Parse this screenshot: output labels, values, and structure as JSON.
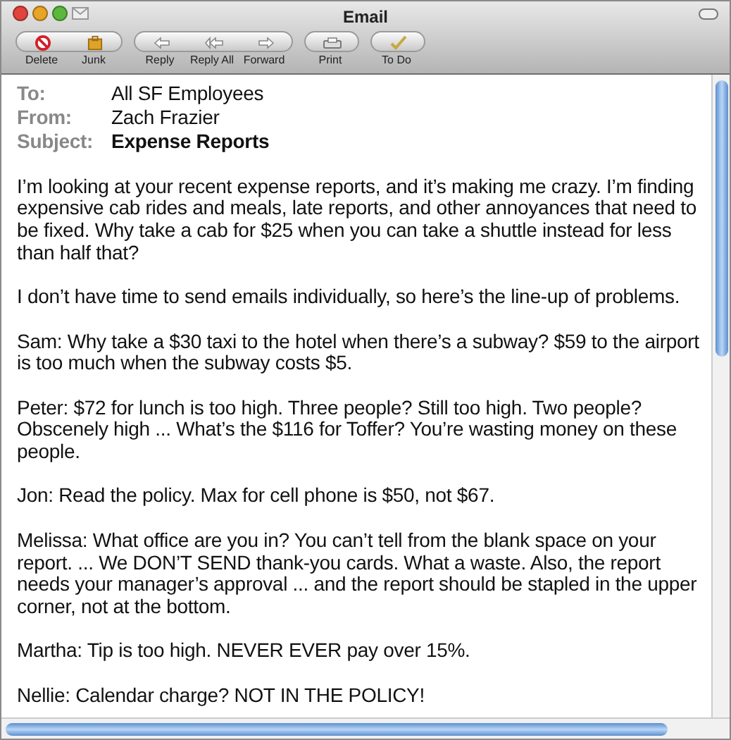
{
  "window": {
    "title": "Email"
  },
  "toolbar": [
    {
      "buttons": [
        {
          "label": "Delete",
          "kind": "delete"
        },
        {
          "label": "Junk",
          "kind": "junk"
        }
      ]
    },
    {
      "buttons": [
        {
          "label": "Reply",
          "kind": "reply"
        },
        {
          "label": "Reply All",
          "kind": "reply_all"
        },
        {
          "label": "Forward",
          "kind": "forward"
        }
      ]
    },
    {
      "buttons": [
        {
          "label": "Print",
          "kind": "print"
        }
      ]
    },
    {
      "buttons": [
        {
          "label": "To Do",
          "kind": "todo"
        }
      ]
    }
  ],
  "headers": [
    {
      "label": "To:",
      "value": "All SF Employees",
      "bold": false
    },
    {
      "label": "From:",
      "value": "Zach Frazier",
      "bold": false
    },
    {
      "label": "Subject:",
      "value": "Expense Reports",
      "bold": true
    }
  ],
  "paragraphs": [
    "I’m looking at your recent expense reports, and it’s making me crazy. I’m finding expensive cab rides and meals, late reports, and other annoyances that need to be fixed. Why take a cab for $25 when you can take a shuttle instead for less than half that?",
    "I don’t have time to send emails individually, so here’s the line-up of problems.",
    "Sam: Why take a $30 taxi to the hotel when there’s a subway? $59 to the airport is too much when the subway costs $5.",
    "Peter: $72 for lunch is too high. Three people? Still too high. Two people? Obscenely high ... What’s the $116 for Toffer? You’re wasting money on these people.",
    "Jon: Read the policy. Max for cell phone is $50, not $67.",
    "Melissa: What office are you in? You can’t tell from the blank space on your report. ... We DON’T SEND thank-you cards. What a waste. Also, the report needs your manager’s approval ... and the report should be stapled in the upper corner, not at the bottom.",
    "Martha: Tip is too high. NEVER EVER pay over 15%.",
    "Nellie: Calendar charge? NOT IN THE POLICY!"
  ]
}
